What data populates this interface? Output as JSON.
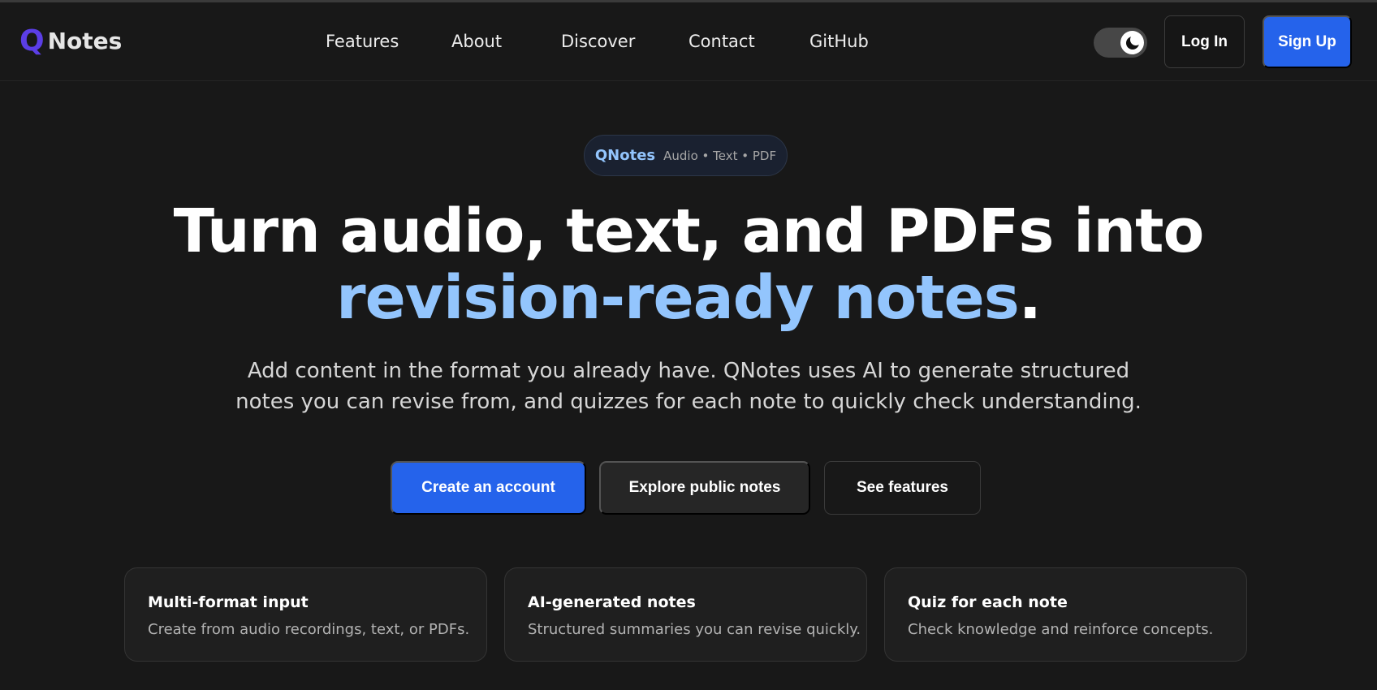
{
  "brand": {
    "logo_letter": "Q",
    "name": "Notes"
  },
  "nav": {
    "links": [
      "Features",
      "About",
      "Discover",
      "Contact",
      "GitHub"
    ]
  },
  "header": {
    "theme_toggle_icon": "moon-icon",
    "login_label": "Log In",
    "signup_label": "Sign Up"
  },
  "hero": {
    "pill_brand": "QNotes",
    "pill_formats": "Audio • Text • PDF",
    "title_line1": "Turn audio, text, and PDFs into",
    "title_accent": "revision-ready notes",
    "title_period": ".",
    "subtitle_line1": "Add content in the format you already have. QNotes uses AI to generate structured",
    "subtitle_line2": "notes you can revise from, and quizzes for each note to quickly check understanding."
  },
  "cta": {
    "primary": "Create an account",
    "secondary": "Explore public notes",
    "outline": "See features"
  },
  "features": [
    {
      "title": "Multi-format input",
      "description": "Create from audio recordings, text, or PDFs."
    },
    {
      "title": "AI-generated notes",
      "description": "Structured summaries you can revise quickly."
    },
    {
      "title": "Quiz for each note",
      "description": "Check knowledge and reinforce concepts."
    }
  ],
  "colors": {
    "background": "#181818",
    "accent_blue": "#2563eb",
    "accent_light_blue": "#93c5fd",
    "logo_purple": "#5b3ee6"
  }
}
